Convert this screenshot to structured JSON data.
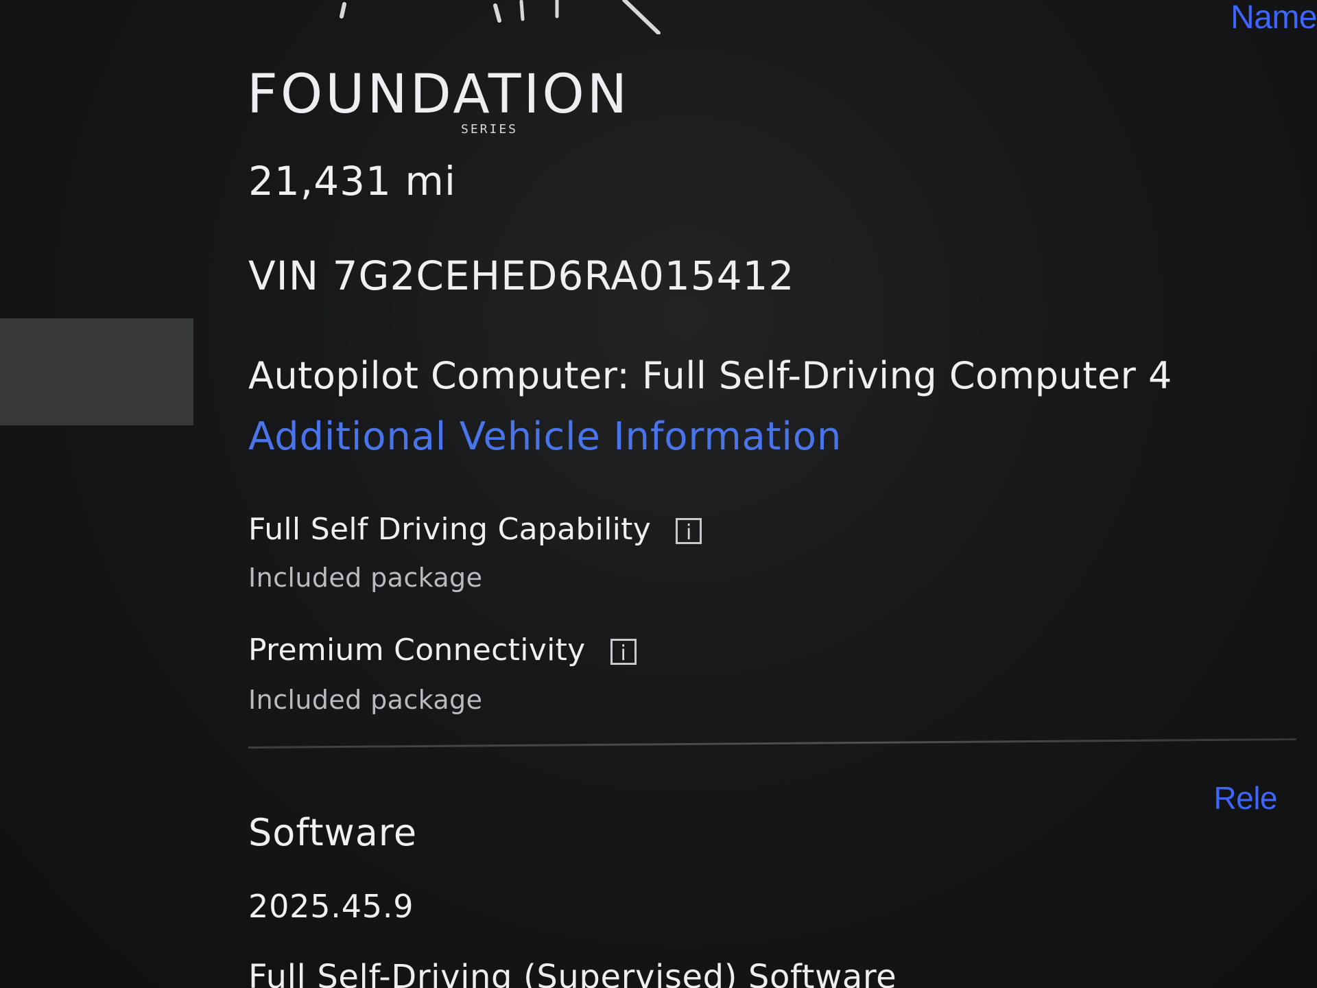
{
  "top": {
    "top_right_link": "Name"
  },
  "vehicle": {
    "mileage": "21,431 mi",
    "vin": "VIN 7G2CEHED6RA015412",
    "autopilot": "Autopilot Computer: Full Self-Driving Computer 4",
    "additional_link": "Additional Vehicle Information",
    "logo": {
      "text": "FOUNDATION",
      "subtext": "SERIES"
    }
  },
  "features": [
    {
      "title": "Full Self Driving Capability",
      "subtitle": "Included package",
      "icon": "info-icon"
    },
    {
      "title": "Premium Connectivity",
      "subtitle": "Included package",
      "icon": "info-icon"
    }
  ],
  "software": {
    "title": "Software",
    "release_link": "Rele",
    "version": "2025.45.9",
    "next_label": "Full Self-Driving (Supervised) Software"
  },
  "colors": {
    "background": "#151617",
    "primary_text": "#eef0f2",
    "secondary_text": "#b8bcc1",
    "link": "#4a75ea",
    "bright_link": "#3d66ff",
    "sidebar_highlight": "#3b3c3e"
  }
}
